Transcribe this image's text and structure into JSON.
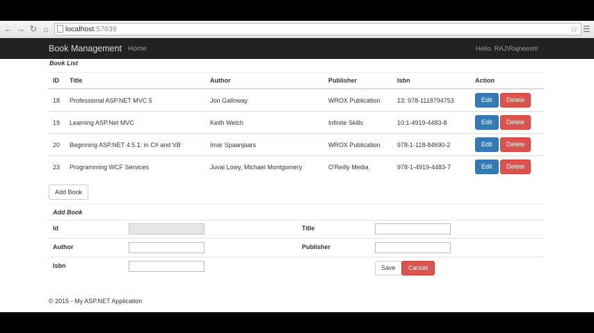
{
  "browser": {
    "url_host": "localhost",
    "url_port": ":57639"
  },
  "navbar": {
    "brand": "Book Management",
    "home": "Home",
    "user_greeting": "Hello, RAJ\\Rajneesh!"
  },
  "book_list": {
    "title": "Book List",
    "columns": [
      "ID",
      "Title",
      "Author",
      "Publisher",
      "Isbn",
      "Action"
    ],
    "rows": [
      {
        "id": "18",
        "title": "Professional ASP.NET MVC 5",
        "author": "Jon Galloway",
        "publisher": "WROX Publication",
        "isbn": "13: 978-1118794753"
      },
      {
        "id": "19",
        "title": "Learning ASP.Net MVC",
        "author": "Keith Welch",
        "publisher": "Infinite Skills",
        "isbn": "10:1-4919-4483-8"
      },
      {
        "id": "20",
        "title": "Beginning ASP.NET 4.5.1: in C# and VB",
        "author": "Imar Spaanjaars",
        "publisher": "WROX Publication",
        "isbn": "978-1-118-84690-2"
      },
      {
        "id": "23",
        "title": "Programming WCF Services",
        "author": "Juval Lowy, Michael Montgomery",
        "publisher": "O'Reilly Media",
        "isbn": "978-1-4919-4483-7"
      }
    ],
    "edit_label": "Edit",
    "delete_label": "Delete",
    "add_book_button": "Add Book"
  },
  "add_book_form": {
    "title": "Add Book",
    "id_label": "Id",
    "title_label": "Title",
    "author_label": "Author",
    "publisher_label": "Publisher",
    "isbn_label": "Isbn",
    "id_value": "",
    "title_value": "",
    "author_value": "",
    "publisher_value": "",
    "isbn_value": "",
    "save_label": "Save",
    "cancel_label": "Cancel"
  },
  "footer": {
    "text": "© 2015 - My ASP.NET Application"
  },
  "colors": {
    "primary": "#337ab7",
    "danger": "#d9534f",
    "navbar": "#222222"
  }
}
